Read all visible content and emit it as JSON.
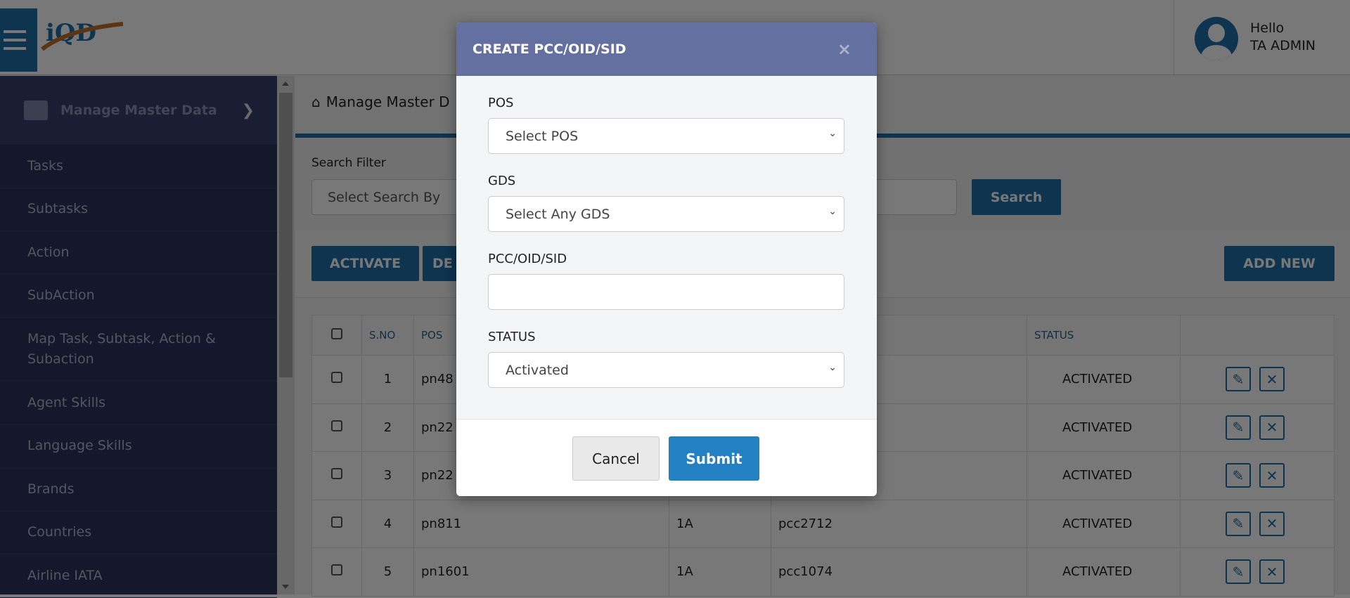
{
  "header": {
    "logo_text": "iQD",
    "greeting": "Hello",
    "user": "TA ADMIN"
  },
  "sidebar": {
    "section": "Manage Master Data",
    "items": [
      {
        "label": "Tasks"
      },
      {
        "label": "Subtasks"
      },
      {
        "label": "Action"
      },
      {
        "label": "SubAction"
      },
      {
        "label": "Map Task, Subtask, Action & Subaction"
      },
      {
        "label": "Agent Skills"
      },
      {
        "label": "Language Skills"
      },
      {
        "label": "Brands"
      },
      {
        "label": "Countries"
      },
      {
        "label": "Airline IATA"
      }
    ]
  },
  "breadcrumb": "Manage Master D",
  "filter": {
    "label": "Search Filter",
    "select_placeholder": "Select Search By",
    "search_label": "Search"
  },
  "actions": {
    "activate": "ACTIVATE",
    "deactivate": "DE",
    "add_new": "ADD NEW"
  },
  "table": {
    "headers": [
      "S.NO",
      "POS",
      "",
      "",
      "STATUS"
    ],
    "rows": [
      {
        "sno": "1",
        "pos": "pn48",
        "gds": "",
        "pcc": "",
        "status": "ACTIVATED"
      },
      {
        "sno": "2",
        "pos": "pn22",
        "gds": "",
        "pcc": "",
        "status": "ACTIVATED"
      },
      {
        "sno": "3",
        "pos": "pn22",
        "gds": "",
        "pcc": "",
        "status": "ACTIVATED"
      },
      {
        "sno": "4",
        "pos": "pn811",
        "gds": "1A",
        "pcc": "pcc2712",
        "status": "ACTIVATED"
      },
      {
        "sno": "5",
        "pos": "pn1601",
        "gds": "1A",
        "pcc": "pcc1074",
        "status": "ACTIVATED"
      }
    ]
  },
  "modal": {
    "title": "CREATE PCC/OID/SID",
    "close": "×",
    "pos_label": "POS",
    "pos_value": "Select POS",
    "gds_label": "GDS",
    "gds_value": "Select Any GDS",
    "pcc_label": "PCC/OID/SID",
    "pcc_value": "",
    "status_label": "STATUS",
    "status_value": "Activated",
    "cancel": "Cancel",
    "submit": "Submit"
  }
}
